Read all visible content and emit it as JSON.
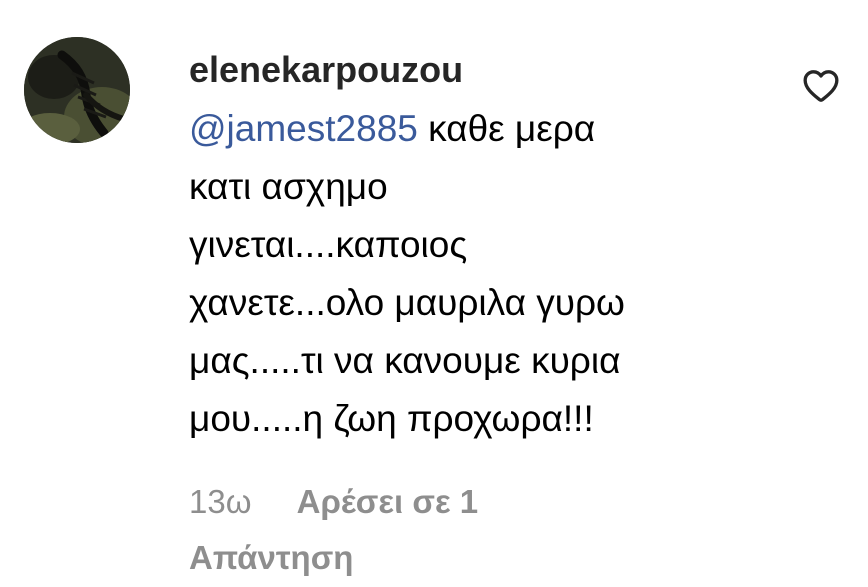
{
  "comment": {
    "username": "elenekarpouzou",
    "avatar_icon": "user-avatar",
    "mention": "@jamest2885",
    "text_lines": [
      " καθε μερα",
      "κατι ασχημο",
      "γινεται....καποιος",
      "χανετε...ολο μαυριλα γυρω",
      "μας.....τι να κανουμε κυρια",
      "μου.....η ζωη προχωρα!!!"
    ],
    "time": "13ω",
    "likes_label": "Αρέσει σε 1",
    "reply_label": "Απάντηση",
    "like_icon": "heart-outline-icon"
  },
  "colors": {
    "mention": "#3a5a9b",
    "meta": "#8e8e8e",
    "username": "#262626"
  }
}
